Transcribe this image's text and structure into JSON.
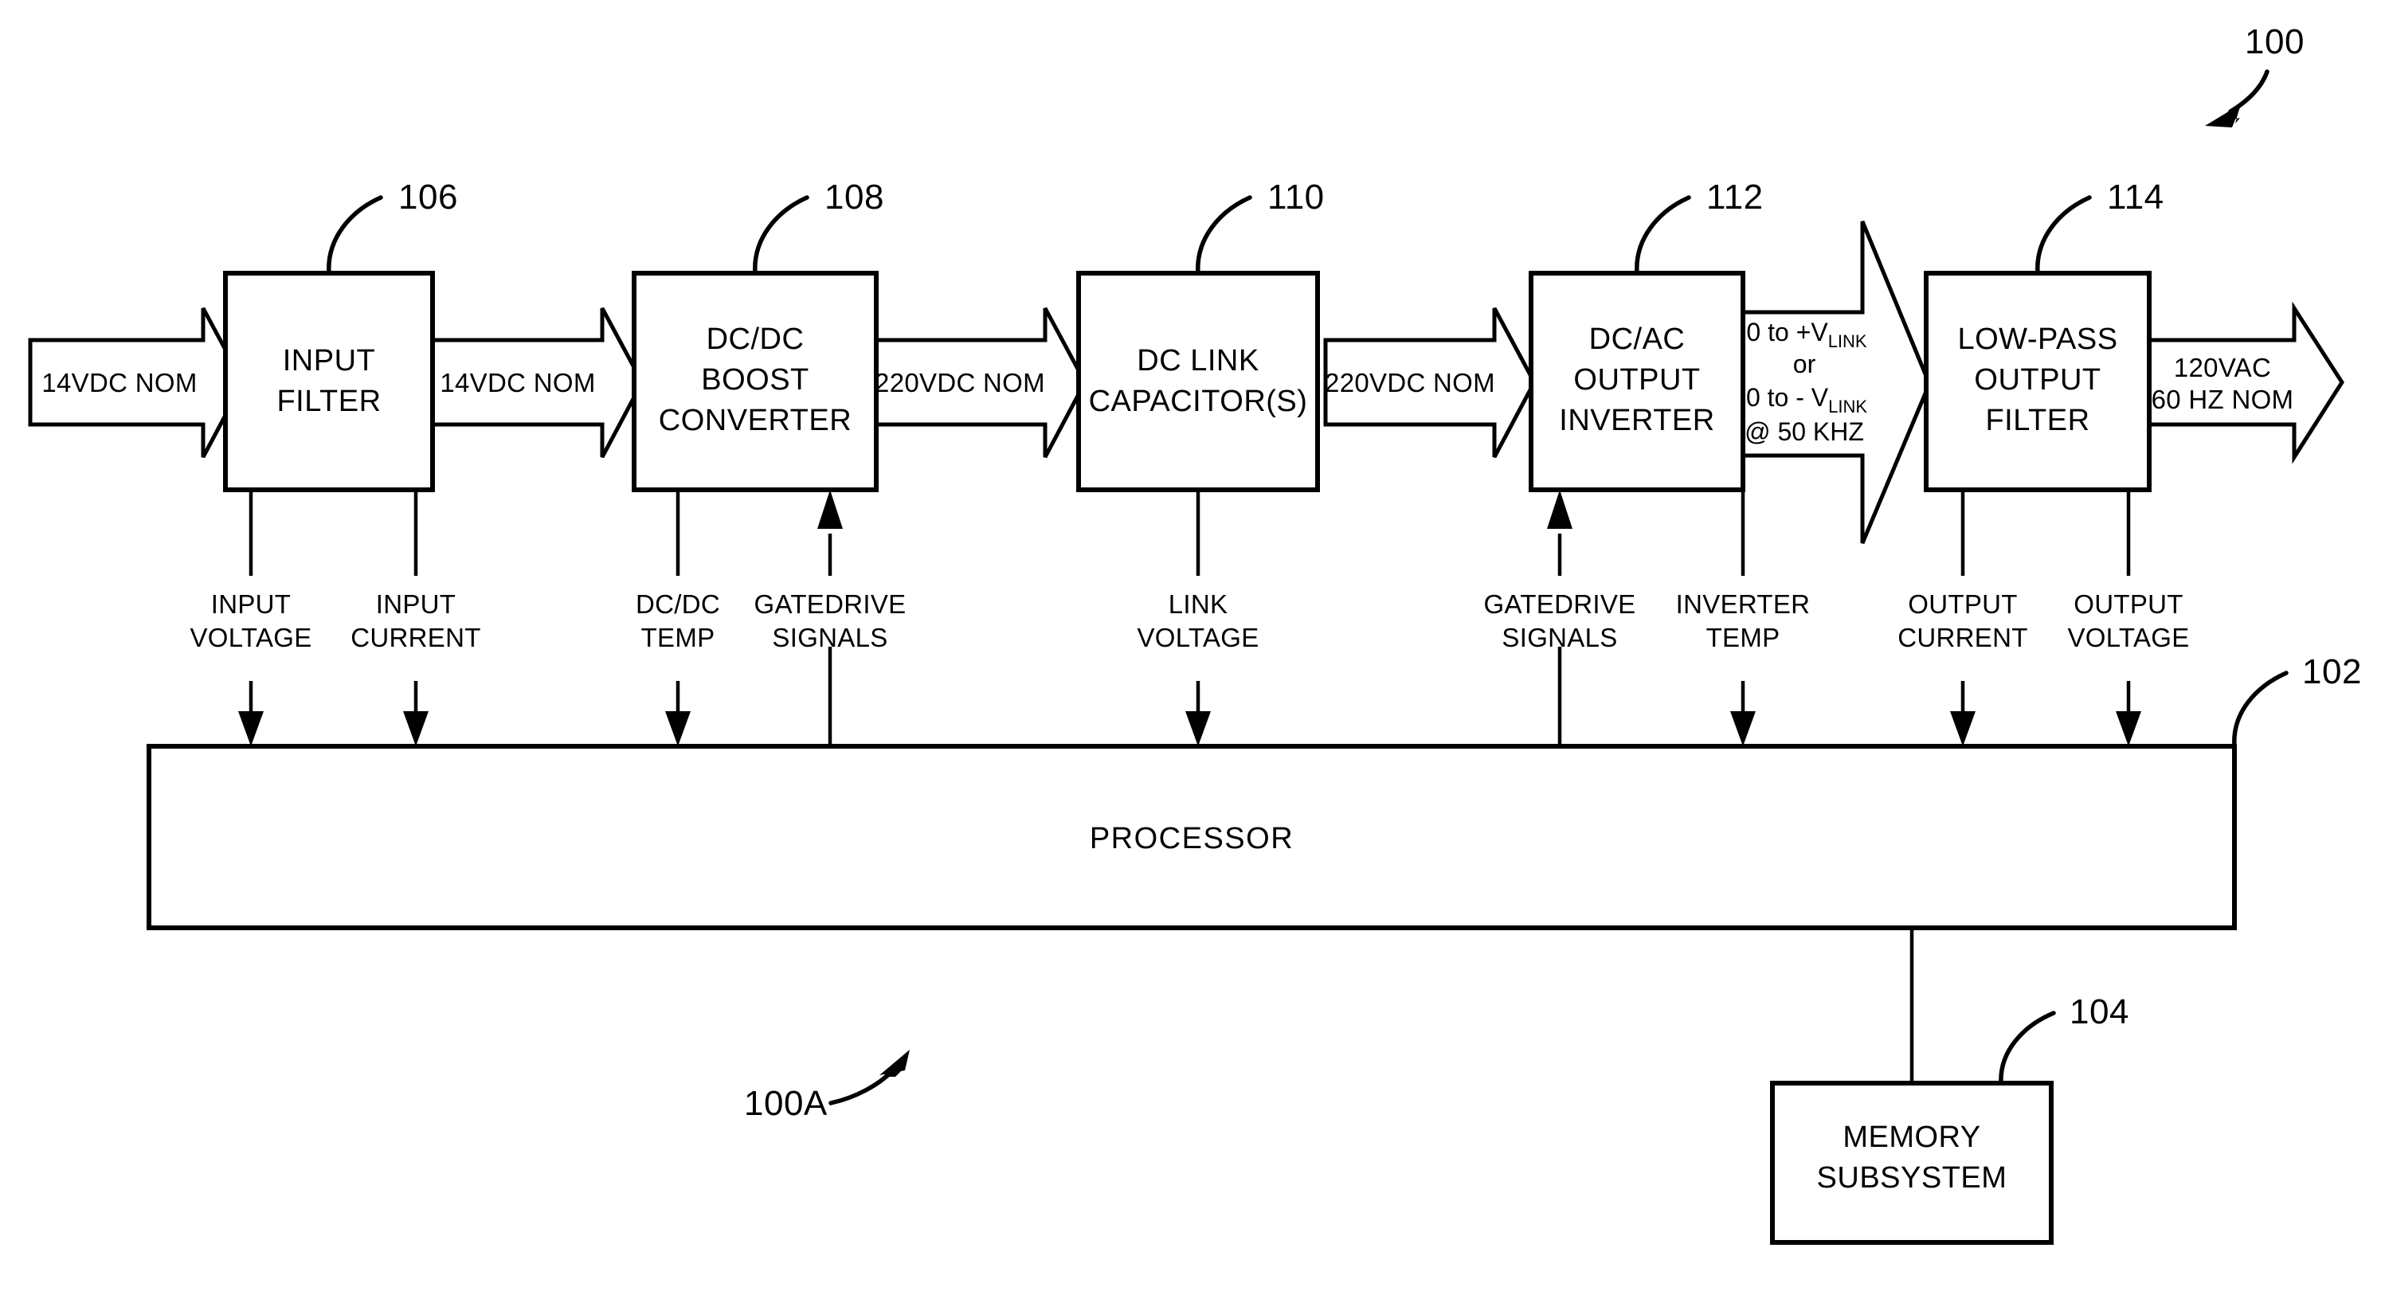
{
  "figure": {
    "ref_main": "100",
    "ref_variant": "100A",
    "ref_processor": "102",
    "ref_memory": "104"
  },
  "blocks": [
    {
      "id": "input-filter",
      "ref": "106",
      "lines": [
        "INPUT",
        "FILTER"
      ]
    },
    {
      "id": "dcdc-boost",
      "ref": "108",
      "lines": [
        "DC/DC",
        "BOOST",
        "CONVERTER"
      ]
    },
    {
      "id": "dc-link-capacitor",
      "ref": "110",
      "lines": [
        "DC LINK",
        "CAPACITOR(S)"
      ]
    },
    {
      "id": "dcac-inverter",
      "ref": "112",
      "lines": [
        "DC/AC",
        "OUTPUT",
        "INVERTER"
      ]
    },
    {
      "id": "low-pass-filter",
      "ref": "114",
      "lines": [
        "LOW-PASS",
        "OUTPUT",
        "FILTER"
      ]
    }
  ],
  "processor": {
    "label": "PROCESSOR"
  },
  "memory": {
    "lines": [
      "MEMORY",
      "SUBSYSTEM"
    ]
  },
  "flow_arrows": [
    {
      "id": "input-supply",
      "lines": [
        "14VDC NOM"
      ]
    },
    {
      "id": "filtered-input",
      "lines": [
        "14VDC NOM"
      ]
    },
    {
      "id": "boosted-dc",
      "lines": [
        "220VDC NOM"
      ]
    },
    {
      "id": "link-dc",
      "lines": [
        "220VDC NOM"
      ]
    },
    {
      "id": "ac-output",
      "lines": [
        "120VAC",
        "60 HZ NOM"
      ]
    }
  ],
  "inverter_output_arrow": {
    "id": "pwm-output",
    "line1_pre": "0 to +V",
    "line1_sub": "LINK",
    "line2": "or",
    "line3_pre": "0 to - V",
    "line3_sub": "LINK",
    "line4": "@ 50 KHZ"
  },
  "signals": [
    {
      "id": "input-voltage",
      "lines": [
        "INPUT",
        "VOLTAGE"
      ],
      "direction": "to-processor"
    },
    {
      "id": "input-current",
      "lines": [
        "INPUT",
        "CURRENT"
      ],
      "direction": "to-processor"
    },
    {
      "id": "dcdc-temp",
      "lines": [
        "DC/DC",
        "TEMP"
      ],
      "direction": "to-processor"
    },
    {
      "id": "dcdc-gatedrive",
      "lines": [
        "GATEDRIVE",
        "SIGNALS"
      ],
      "direction": "from-processor"
    },
    {
      "id": "link-voltage",
      "lines": [
        "LINK",
        "VOLTAGE"
      ],
      "direction": "to-processor"
    },
    {
      "id": "inverter-gatedrive",
      "lines": [
        "GATEDRIVE",
        "SIGNALS"
      ],
      "direction": "from-processor"
    },
    {
      "id": "inverter-temp",
      "lines": [
        "INVERTER",
        "TEMP"
      ],
      "direction": "to-processor"
    },
    {
      "id": "output-current",
      "lines": [
        "OUTPUT",
        "CURRENT"
      ],
      "direction": "to-processor"
    },
    {
      "id": "output-voltage",
      "lines": [
        "OUTPUT",
        "VOLTAGE"
      ],
      "direction": "to-processor"
    }
  ]
}
